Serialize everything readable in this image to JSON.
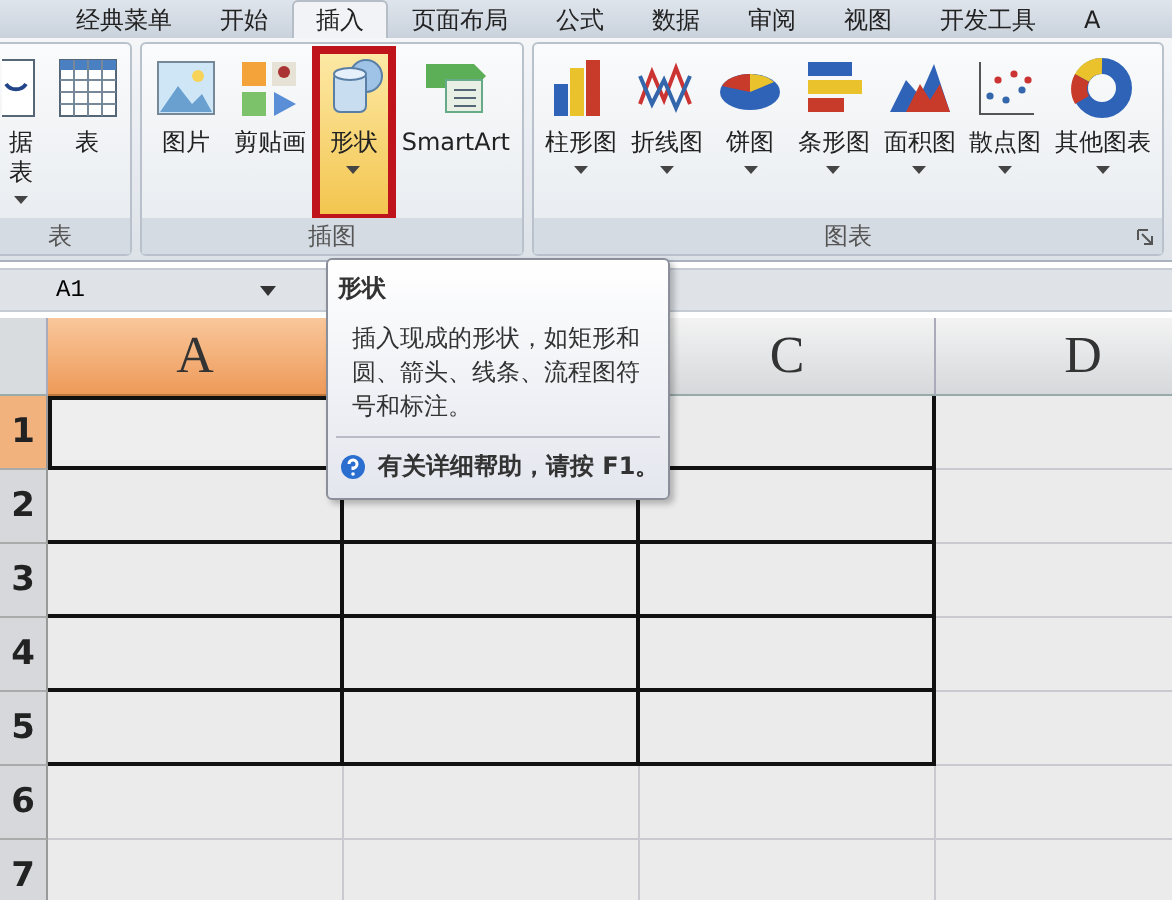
{
  "ribbon_tabs": [
    {
      "label": "经典菜单",
      "selected": false
    },
    {
      "label": "开始",
      "selected": false
    },
    {
      "label": "插入",
      "selected": true
    },
    {
      "label": "页面布局",
      "selected": false
    },
    {
      "label": "公式",
      "selected": false
    },
    {
      "label": "数据",
      "selected": false
    },
    {
      "label": "审阅",
      "selected": false
    },
    {
      "label": "视图",
      "selected": false
    },
    {
      "label": "开发工具",
      "selected": false
    },
    {
      "label": "A",
      "selected": false
    }
  ],
  "ribbon_groups": [
    {
      "label": "表",
      "launcher": false,
      "buttons": [
        {
          "lines": [
            "据",
            "表"
          ],
          "caret": true,
          "selected": false
        },
        {
          "lines": [
            "表"
          ],
          "caret": false,
          "selected": false
        }
      ]
    },
    {
      "label": "插图",
      "launcher": false,
      "buttons": [
        {
          "lines": [
            "图片"
          ],
          "caret": false,
          "selected": false
        },
        {
          "lines": [
            "剪贴画"
          ],
          "caret": false,
          "selected": false
        },
        {
          "lines": [
            "形状"
          ],
          "caret": true,
          "selected": true
        },
        {
          "lines": [
            "SmartArt"
          ],
          "caret": false,
          "selected": false
        }
      ]
    },
    {
      "label": "图表",
      "launcher": true,
      "buttons": [
        {
          "lines": [
            "柱形图"
          ],
          "caret": true,
          "selected": false
        },
        {
          "lines": [
            "折线图"
          ],
          "caret": true,
          "selected": false
        },
        {
          "lines": [
            "饼图"
          ],
          "caret": true,
          "selected": false
        },
        {
          "lines": [
            "条形图"
          ],
          "caret": true,
          "selected": false
        },
        {
          "lines": [
            "面积图"
          ],
          "caret": true,
          "selected": false
        },
        {
          "lines": [
            "散点图"
          ],
          "caret": true,
          "selected": false
        },
        {
          "lines": [
            "其他图表"
          ],
          "caret": true,
          "selected": false
        }
      ]
    }
  ],
  "name_box": {
    "value": "A1"
  },
  "sheet": {
    "columns": [
      {
        "label": "A",
        "selected": true,
        "bordered": true
      },
      {
        "bordered": true
      },
      {
        "label": "C",
        "selected": false,
        "bordered": true
      },
      {
        "label": "D",
        "selected": false,
        "bordered": false
      }
    ],
    "rows": [
      {
        "label": "1",
        "selected": true,
        "bordered": true
      },
      {
        "label": "2",
        "selected": false,
        "bordered": true
      },
      {
        "label": "3",
        "selected": false,
        "bordered": true
      },
      {
        "label": "4",
        "selected": false,
        "bordered": true
      },
      {
        "label": "5",
        "selected": false,
        "bordered": true
      },
      {
        "label": "6",
        "selected": false,
        "bordered": false
      },
      {
        "label": "7",
        "selected": false,
        "bordered": false
      }
    ]
  },
  "tooltip": {
    "title": "形状",
    "body": "插入现成的形状，如矩形和圆、箭头、线条、流程图符号和标注。",
    "help": "有关详细帮助，请按 F1。"
  }
}
